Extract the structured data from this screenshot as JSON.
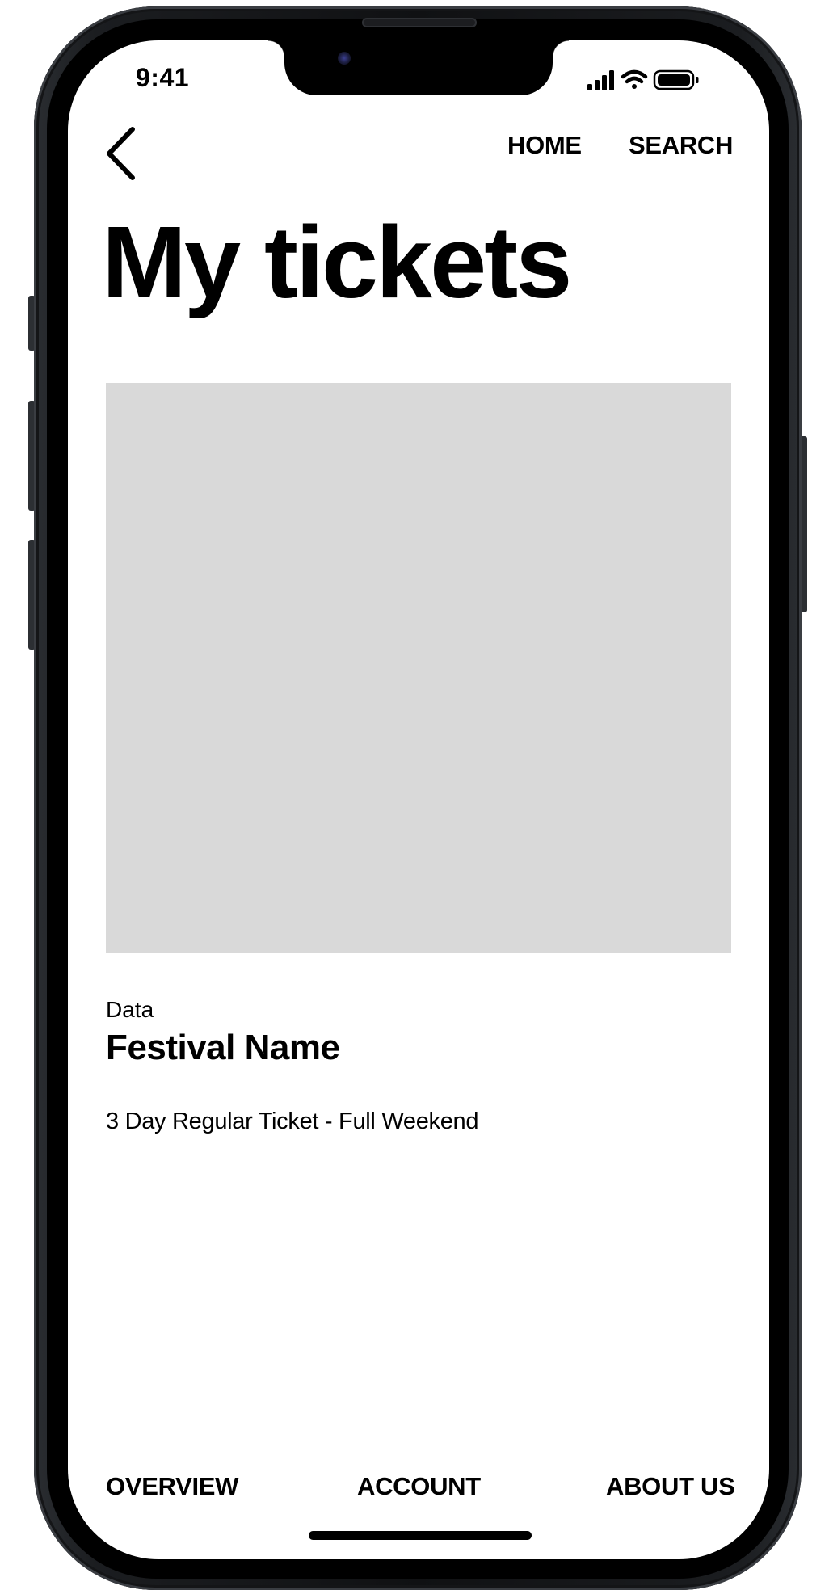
{
  "status_bar": {
    "time": "9:41"
  },
  "header": {
    "nav": {
      "home": "HOME",
      "search": "SEARCH"
    }
  },
  "page": {
    "title": "My tickets"
  },
  "ticket": {
    "date_label": "Data",
    "festival_name": "Festival Name",
    "ticket_type": "3 Day Regular Ticket - Full Weekend"
  },
  "bottom_nav": {
    "overview": "OVERVIEW",
    "account": "ACCOUNT",
    "about": "ABOUT US"
  },
  "icons": {
    "back": "chevron-left-icon",
    "signal": "cellular-signal-icon",
    "wifi": "wifi-icon",
    "battery": "battery-icon"
  },
  "colors": {
    "text": "#000000",
    "background": "#ffffff",
    "image_placeholder": "#d9d9d9"
  }
}
